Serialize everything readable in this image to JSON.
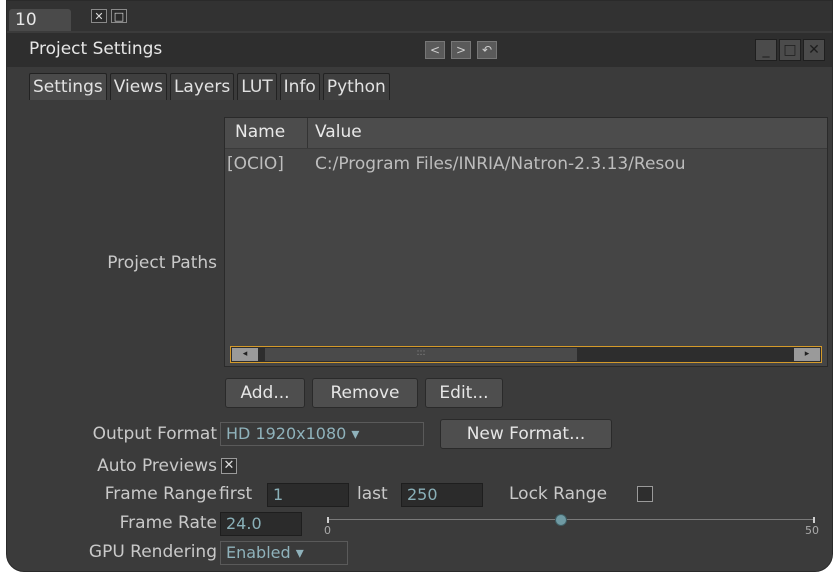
{
  "pane": {
    "tab_label": "10",
    "close_glyph": "✕",
    "float_glyph": "□"
  },
  "window": {
    "title": "Project Settings",
    "prev": "<",
    "next": ">",
    "restore": "↶",
    "minimize": "_",
    "maximize": "□",
    "close": "✕"
  },
  "tabs": [
    {
      "label": "Settings"
    },
    {
      "label": "Views"
    },
    {
      "label": "Layers"
    },
    {
      "label": "LUT"
    },
    {
      "label": "Info"
    },
    {
      "label": "Python"
    }
  ],
  "project_paths": {
    "label": "Project Paths",
    "columns": [
      "Name",
      "Value"
    ],
    "rows": [
      {
        "name": "[OCIO]",
        "value": "C:/Program Files/INRIA/Natron-2.3.13/Resou"
      }
    ],
    "scroll_left": "◂",
    "scroll_right": "▸",
    "scroll_grip": ":::"
  },
  "path_buttons": {
    "add": "Add...",
    "remove": "Remove",
    "edit": "Edit..."
  },
  "output_format": {
    "label": "Output Format",
    "value": "HD 1920x1080 ▾",
    "new_format": "New Format..."
  },
  "auto_previews": {
    "label": "Auto Previews",
    "checked_glyph": "✕"
  },
  "frame_range": {
    "label": "Frame Range",
    "first_label": "first",
    "first_value": "1",
    "last_label": "last",
    "last_value": "250",
    "lock_label": "Lock Range"
  },
  "frame_rate": {
    "label": "Frame Rate",
    "value": "24.0",
    "slider_min": "0",
    "slider_max": "50",
    "slider_value": 24
  },
  "gpu_rendering": {
    "label": "GPU Rendering",
    "value": "Enabled ▾"
  },
  "colors": {
    "accent": "#d49a2a",
    "value_text": "#8fb2bb",
    "panel": "#3b3b3b"
  }
}
